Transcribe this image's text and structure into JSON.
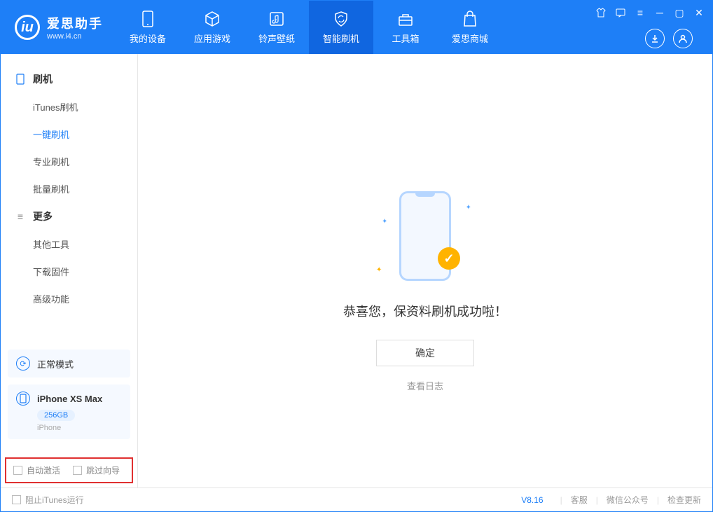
{
  "app": {
    "name": "爱思助手",
    "url": "www.i4.cn"
  },
  "nav": {
    "items": [
      {
        "label": "我的设备"
      },
      {
        "label": "应用游戏"
      },
      {
        "label": "铃声壁纸"
      },
      {
        "label": "智能刷机"
      },
      {
        "label": "工具箱"
      },
      {
        "label": "爱思商城"
      }
    ]
  },
  "sidebar": {
    "group1_label": "刷机",
    "group1_items": [
      {
        "label": "iTunes刷机"
      },
      {
        "label": "一键刷机"
      },
      {
        "label": "专业刷机"
      },
      {
        "label": "批量刷机"
      }
    ],
    "group2_label": "更多",
    "group2_items": [
      {
        "label": "其他工具"
      },
      {
        "label": "下载固件"
      },
      {
        "label": "高级功能"
      }
    ],
    "mode_card": "正常模式",
    "device": {
      "name": "iPhone XS Max",
      "storage": "256GB",
      "type": "iPhone"
    },
    "auto_activate": "自动激活",
    "skip_guide": "跳过向导"
  },
  "main": {
    "success_text": "恭喜您，保资料刷机成功啦！",
    "ok_label": "确定",
    "log_link": "查看日志"
  },
  "footer": {
    "block_itunes": "阻止iTunes运行",
    "version": "V8.16",
    "cs": "客服",
    "wechat": "微信公众号",
    "update": "检查更新"
  }
}
